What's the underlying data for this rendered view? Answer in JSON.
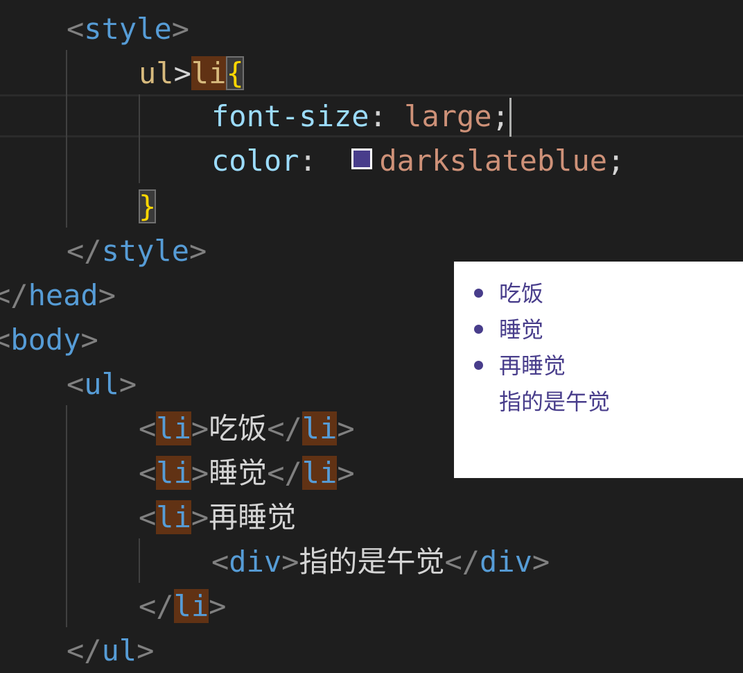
{
  "editor": {
    "lines": {
      "style_open": {
        "lt": "<",
        "name": "style",
        "gt": ">"
      },
      "selector": {
        "ul": "ul",
        "gt": ">",
        "li": "li",
        "brace_open": "{"
      },
      "font_size": {
        "prop": "font-size",
        "colon": ": ",
        "value": "large",
        "semi": ";"
      },
      "color": {
        "prop": "color",
        "colon": ": ",
        "value": "darkslateblue",
        "semi": ";"
      },
      "brace_close": "}",
      "style_close": {
        "lt": "</",
        "name": "style",
        "gt": ">"
      },
      "head_close": {
        "lt": "</",
        "name": "head",
        "gt": ">"
      },
      "body_open": {
        "lt": "<",
        "name": "body",
        "gt": ">"
      },
      "ul_open": {
        "lt": "<",
        "name": "ul",
        "gt": ">"
      },
      "li1": {
        "lt": "<",
        "name": "li",
        "gt": ">",
        "text": "吃饭",
        "clt": "</",
        "cname": "li",
        "cgt": ">"
      },
      "li2": {
        "lt": "<",
        "name": "li",
        "gt": ">",
        "text": "睡觉",
        "clt": "</",
        "cname": "li",
        "cgt": ">"
      },
      "li3": {
        "lt": "<",
        "name": "li",
        "gt": ">",
        "text": "再睡觉"
      },
      "div": {
        "lt": "<",
        "name": "div",
        "gt": ">",
        "text": "指的是午觉",
        "clt": "</",
        "cname": "div",
        "cgt": ">"
      },
      "li_close": {
        "lt": "</",
        "name": "li",
        "gt": ">"
      },
      "ul_close": {
        "lt": "</",
        "name": "ul",
        "gt": ">"
      }
    },
    "swatch_color": "#483d8b"
  },
  "preview": {
    "items": [
      "吃饭",
      "睡觉",
      "再睡觉"
    ],
    "nested_div": "指的是午觉",
    "text_color": "#483d8b"
  }
}
